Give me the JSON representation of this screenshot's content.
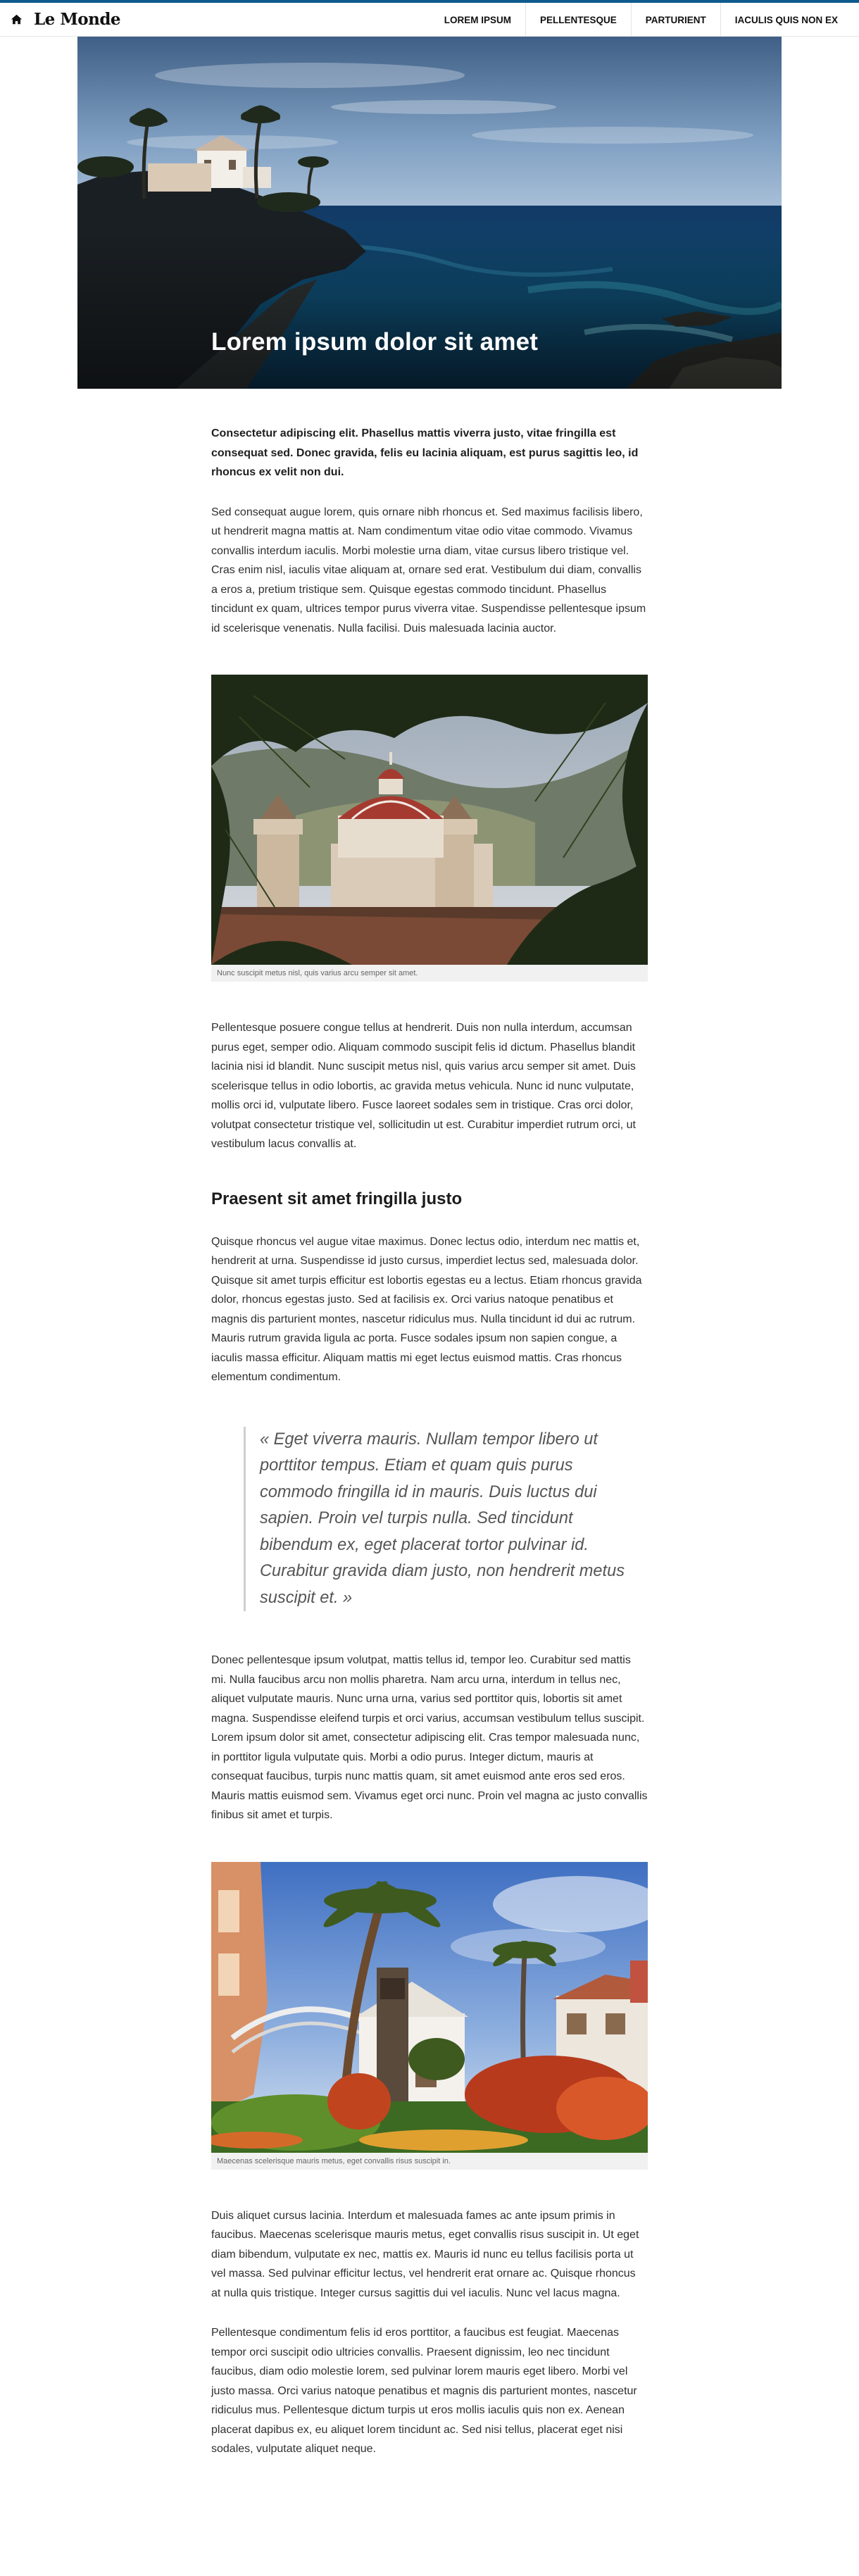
{
  "header": {
    "logo": "Le Monde",
    "home_icon": "home-icon",
    "nav": [
      "LOREM IPSUM",
      "PELLENTESQUE",
      "PARTURIENT",
      "IACULIS QUIS NON EX"
    ],
    "accent_color": "#0d5a8f"
  },
  "hero": {
    "title": "Lorem ipsum dolor sit amet"
  },
  "article": {
    "lead": "Consectetur adipiscing elit. Phasellus mattis viverra justo, vitae fringilla est consequat sed. Donec gravida, felis eu lacinia aliquam, est purus sagittis leo, id rhoncus ex velit non dui.",
    "p1": "Sed consequat augue lorem, quis ornare nibh rhoncus et. Sed maximus facilisis libero, ut hendrerit magna mattis at. Nam condimentum vitae odio vitae commodo. Vivamus convallis interdum iaculis. Morbi molestie urna diam, vitae cursus libero tristique vel. Cras enim nisl, iaculis vitae aliquam at, ornare sed erat. Vestibulum dui diam, convallis a eros a, pretium tristique sem. Quisque egestas commodo tincidunt. Phasellus tincidunt ex quam, ultrices tempor purus viverra vitae. Suspendisse pellentesque ipsum id scelerisque venenatis. Nulla facilisi. Duis malesuada lacinia auctor.",
    "figure1_caption": "Nunc suscipit metus nisl, quis varius arcu semper sit amet.",
    "p2": "Pellentesque posuere congue tellus at hendrerit. Duis non nulla interdum, accumsan purus eget, semper odio. Aliquam commodo suscipit felis id dictum. Phasellus blandit lacinia nisi id blandit. Nunc suscipit metus nisl, quis varius arcu semper sit amet. Duis scelerisque tellus in odio lobortis, ac gravida metus vehicula. Nunc id nunc vulputate, mollis orci id, vulputate libero. Fusce laoreet sodales sem in tristique. Cras orci dolor, volutpat consectetur tristique vel, sollicitudin ut est. Curabitur imperdiet rutrum orci, ut vestibulum lacus convallis at.",
    "section_heading": "Praesent sit amet fringilla justo",
    "p3": "Quisque rhoncus vel augue vitae maximus. Donec lectus odio, interdum nec mattis et, hendrerit at urna. Suspendisse id justo cursus, imperdiet lectus sed, malesuada dolor. Quisque sit amet turpis efficitur est lobortis egestas eu a lectus. Etiam rhoncus gravida dolor, rhoncus egestas justo. Sed at facilisis ex. Orci varius natoque penatibus et magnis dis parturient montes, nascetur ridiculus mus. Nulla tincidunt id dui ac rutrum. Mauris rutrum gravida ligula ac porta. Fusce sodales ipsum non sapien congue, a iaculis massa efficitur. Aliquam mattis mi eget lectus euismod mattis. Cras rhoncus elementum condimentum.",
    "quote": "« Eget viverra mauris. Nullam tempor libero ut porttitor tempus. Etiam et quam quis purus commodo fringilla id in mauris. Duis luctus dui sapien. Proin vel turpis nulla. Sed tincidunt bibendum ex, eget placerat tortor pulvinar id. Curabitur gravida diam justo, non hendrerit metus suscipit et. »",
    "p4": "Donec pellentesque ipsum volutpat, mattis tellus id, tempor leo. Curabitur sed mattis mi. Nulla faucibus arcu non mollis pharetra. Nam arcu urna, interdum in tellus nec, aliquet vulputate mauris. Nunc urna urna, varius sed porttitor quis, lobortis sit amet magna. Suspendisse eleifend turpis et orci varius, accumsan vestibulum tellus suscipit. Lorem ipsum dolor sit amet, consectetur adipiscing elit. Cras tempor malesuada nunc, in porttitor ligula vulputate quis. Morbi a odio purus. Integer dictum, mauris at consequat faucibus, turpis nunc mattis quam, sit amet euismod ante eros sed eros. Mauris mattis euismod sem. Vivamus eget orci nunc. Proin vel magna ac justo convallis finibus sit amet et turpis.",
    "figure2_caption": "Maecenas scelerisque mauris metus, eget convallis risus suscipit in.",
    "p5": "Duis aliquet cursus lacinia. Interdum et malesuada fames ac ante ipsum primis in faucibus. Maecenas scelerisque mauris metus, eget convallis risus suscipit in. Ut eget diam bibendum, vulputate ex nec, mattis ex. Mauris id nunc eu tellus facilisis porta ut vel massa. Sed pulvinar efficitur lectus, vel hendrerit erat ornare ac. Quisque rhoncus at nulla quis tristique. Integer cursus sagittis dui vel iaculis. Nunc vel lacus magna.",
    "p6": "Pellentesque condimentum felis id eros porttitor, a faucibus est feugiat. Maecenas tempor orci suscipit odio ultricies convallis. Praesent dignissim, leo nec tincidunt faucibus, diam odio molestie lorem, sed pulvinar lorem mauris eget libero. Morbi vel justo massa. Orci varius natoque penatibus et magnis dis parturient montes, nascetur ridiculus mus. Pellentesque dictum turpis ut eros mollis iaculis quis non ex. Aenean placerat dapibus ex, eu aliquet lorem tincidunt ac. Sed nisi tellus, placerat eget nisi sodales, vulputate aliquet neque."
  }
}
